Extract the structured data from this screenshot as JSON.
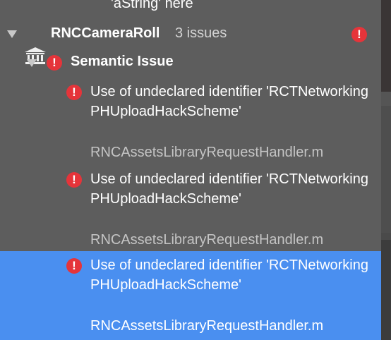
{
  "previous_row_text": "'aString' here",
  "project": {
    "name": "RNCCameraRoll",
    "issue_count": "3 issues",
    "icon": "building-icon",
    "status_icon": "error-icon"
  },
  "group": {
    "label": "Semantic Issue",
    "icon": "error-icon"
  },
  "issues": [
    {
      "message": "Use of undeclared identifier 'RCTNetworkingPHUploadHackScheme'",
      "file": "RNCAssetsLibraryRequestHandler.m",
      "selected": false
    },
    {
      "message": "Use of undeclared identifier 'RCTNetworkingPHUploadHackScheme'",
      "file": "RNCAssetsLibraryRequestHandler.m",
      "selected": false
    },
    {
      "message": "Use of undeclared identifier 'RCTNetworkingPHUploadHackScheme'",
      "file": "RNCAssetsLibraryRequestHandler.m",
      "selected": true
    }
  ],
  "colors": {
    "background": "#5d5d5d",
    "selection": "#4a8ff0",
    "error": "#e5343a",
    "secondary_text": "#c4c4c4"
  }
}
